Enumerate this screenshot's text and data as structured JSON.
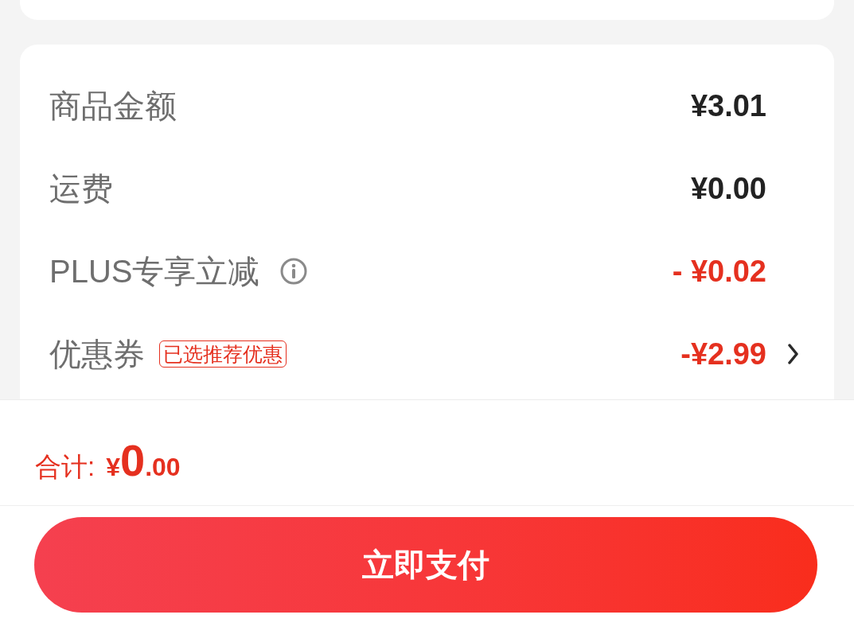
{
  "summary": {
    "rows": [
      {
        "kind": "amount",
        "label": "商品金额",
        "value": "¥3.01"
      },
      {
        "kind": "amount",
        "label": "运费",
        "value": "¥0.00"
      },
      {
        "kind": "discount",
        "label": "PLUS专享立减",
        "value": "- ¥0.02"
      },
      {
        "kind": "coupon",
        "label": "优惠券",
        "tag": "已选推荐优惠",
        "value": "-¥2.99"
      }
    ]
  },
  "footer": {
    "total_label": "合计:",
    "total": {
      "currency": "¥",
      "integer": "0",
      "decimal": ".00"
    }
  },
  "pay_button": {
    "label": "立即支付"
  }
}
